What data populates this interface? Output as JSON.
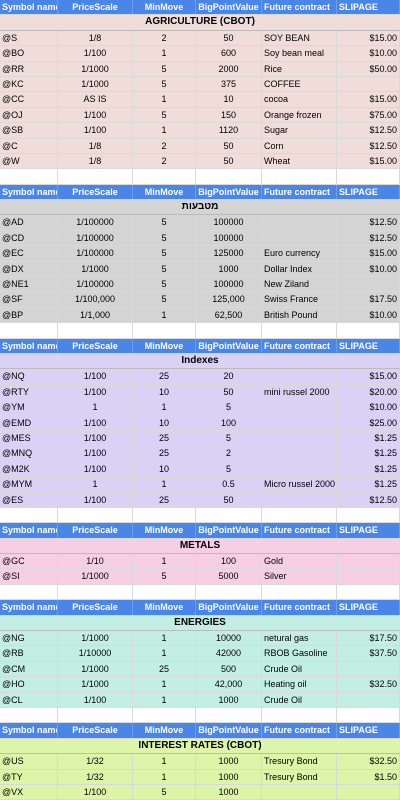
{
  "headers": [
    "Symbol name",
    "PriceScale",
    "MinMove",
    "BigPointValue",
    "Future contract",
    "SLIPAGE"
  ],
  "sections": [
    {
      "title": "AGRICULTURE (CBOT)",
      "title_color": "#f0ddd9",
      "row_color": "#f0ddd9",
      "rows": [
        [
          "@S",
          "1/8",
          "2",
          "50",
          "SOY BEAN",
          "$15.00"
        ],
        [
          "@BO",
          "1/100",
          "1",
          "600",
          "Soy bean meal",
          "$10.00"
        ],
        [
          "@RR",
          "1/1000",
          "5",
          "2000",
          "Rice",
          "$50.00"
        ],
        [
          "@KC",
          "1/1000",
          "5",
          "375",
          "COFFEE",
          ""
        ],
        [
          "@CC",
          "AS IS",
          "1",
          "10",
          "cocoa",
          "$15.00"
        ],
        [
          "@OJ",
          "1/100",
          "5",
          "150",
          "Orange frozen",
          "$75.00"
        ],
        [
          "@SB",
          "1/100",
          "1",
          "1120",
          "Sugar",
          "$12.50"
        ],
        [
          "@C",
          "1/8",
          "2",
          "50",
          "Corn",
          "$12.50"
        ],
        [
          "@W",
          "1/8",
          "2",
          "50",
          "Wheat",
          "$15.00"
        ]
      ]
    },
    {
      "title": "מטבעות",
      "title_color": "#d4d4d4",
      "row_color": "#d4d4d4",
      "rows": [
        [
          "@AD",
          "1/100000",
          "5",
          "100000",
          "",
          "$12.50"
        ],
        [
          "@CD",
          "1/100000",
          "5",
          "100000",
          "",
          "$12.50"
        ],
        [
          "@EC",
          "1/100000",
          "5",
          "125000",
          "Euro currency",
          "$15.00"
        ],
        [
          "@DX",
          "1/1000",
          "5",
          "1000",
          "Dollar Index",
          "$10.00"
        ],
        [
          "@NE1",
          "1/100000",
          "5",
          "100000",
          "New Ziland",
          ""
        ],
        [
          "@SF",
          "1/100,000",
          "5",
          "125,000",
          "Swiss France",
          "$17.50"
        ],
        [
          "@BP",
          "1/1,000",
          "1",
          "62,500",
          "British Pound",
          "$10.00"
        ]
      ]
    },
    {
      "title": "Indexes",
      "title_color": "#d9d2f5",
      "row_color": "#d9d2f5",
      "rows": [
        [
          "@NQ",
          "1/100",
          "25",
          "20",
          "",
          "$15.00"
        ],
        [
          "@RTY",
          "1/100",
          "10",
          "50",
          "mini russel 2000",
          "$20.00"
        ],
        [
          "@YM",
          "1",
          "1",
          "5",
          "",
          "$10.00"
        ],
        [
          "@EMD",
          "1/100",
          "10",
          "100",
          "",
          "$25.00"
        ],
        [
          "@MES",
          "1/100",
          "25",
          "5",
          "",
          "$1.25"
        ],
        [
          "@MNQ",
          "1/100",
          "25",
          "2",
          "",
          "$1.25"
        ],
        [
          "@M2K",
          "1/100",
          "10",
          "5",
          "",
          "$1.25"
        ],
        [
          "@MYM",
          "1",
          "1",
          "0.5",
          "Micro russel 2000",
          "$1.25"
        ],
        [
          "@ES",
          "1/100",
          "25",
          "50",
          "",
          "$12.50"
        ]
      ]
    },
    {
      "title": "METALS",
      "title_color": "#f7cfe5",
      "row_color": "#f7cfe5",
      "rows": [
        [
          "@GC",
          "1/10",
          "1",
          "100",
          "Gold",
          ""
        ],
        [
          "@SI",
          "1/1000",
          "5",
          "5000",
          "Silver",
          ""
        ]
      ]
    },
    {
      "title": "ENERGIES",
      "title_color": "#c3efe3",
      "row_color": "#c3efe3",
      "rows": [
        [
          "@NG",
          "1/1000",
          "1",
          "10000",
          "netural gas",
          "$17.50"
        ],
        [
          "@RB",
          "1/10000",
          "1",
          "42000",
          "RBOB Gasoline",
          "$37.50"
        ],
        [
          "@CM",
          "1/1000",
          "25",
          "500",
          "Crude Oil",
          ""
        ],
        [
          "@HO",
          "1/1000",
          "1",
          "42,000",
          "Heating oil",
          "$32.50"
        ],
        [
          "@CL",
          "1/100",
          "1",
          "1000",
          "Crude Oil",
          ""
        ]
      ]
    },
    {
      "title": "INTEREST RATES (CBOT)",
      "title_color": "#dcf5a8",
      "row_color": "#dcf5a8",
      "rows": [
        [
          "@US",
          "1/32",
          "1",
          "1000",
          "Tresury Bond",
          "$32.50"
        ],
        [
          "@TY",
          "1/32",
          "1",
          "1000",
          "Tresury Bond",
          "$1.50"
        ],
        [
          "@VX",
          "1/100",
          "5",
          "1000",
          "",
          ""
        ]
      ]
    }
  ]
}
